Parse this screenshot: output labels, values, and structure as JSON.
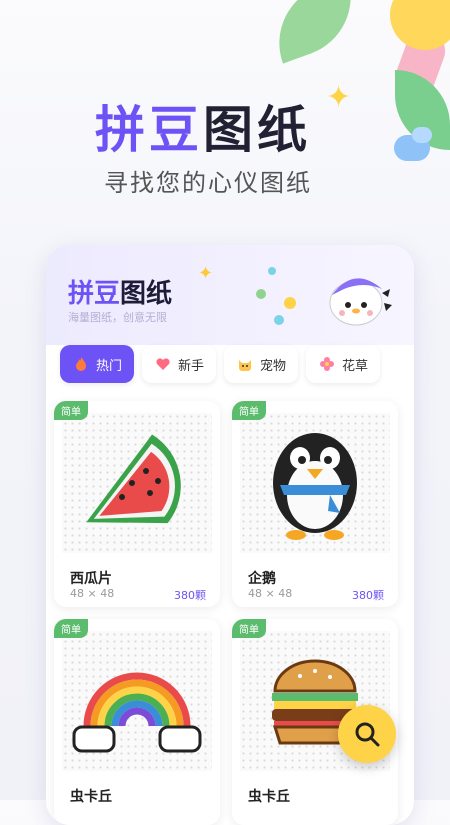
{
  "hero": {
    "title_a": "拼豆",
    "title_b": "图纸",
    "subtitle": "寻找您的心仪图纸"
  },
  "panel": {
    "title_a": "拼豆",
    "title_b": "图纸",
    "subtitle": "海量图纸，创意无限"
  },
  "tabs": [
    {
      "label": "热门",
      "icon": "fire-icon",
      "active": true
    },
    {
      "label": "新手",
      "icon": "heart-icon",
      "active": false
    },
    {
      "label": "宠物",
      "icon": "cat-icon",
      "active": false
    },
    {
      "label": "花草",
      "icon": "flower-icon",
      "active": false
    }
  ],
  "cards": [
    {
      "badge": "简单",
      "name": "西瓜片",
      "size": "48 × 48",
      "count": "380颗",
      "art": "watermelon"
    },
    {
      "badge": "简单",
      "name": "企鹅",
      "size": "48 × 48",
      "count": "380颗",
      "art": "penguin"
    },
    {
      "badge": "简单",
      "name": "虫卡丘",
      "size": "",
      "count": "",
      "art": "rainbow"
    },
    {
      "badge": "简单",
      "name": "虫卡丘",
      "size": "",
      "count": "",
      "art": "burger"
    }
  ],
  "colors": {
    "accent": "#6d53f5",
    "badge": "#5cbc6d",
    "fab": "#ffd347"
  }
}
